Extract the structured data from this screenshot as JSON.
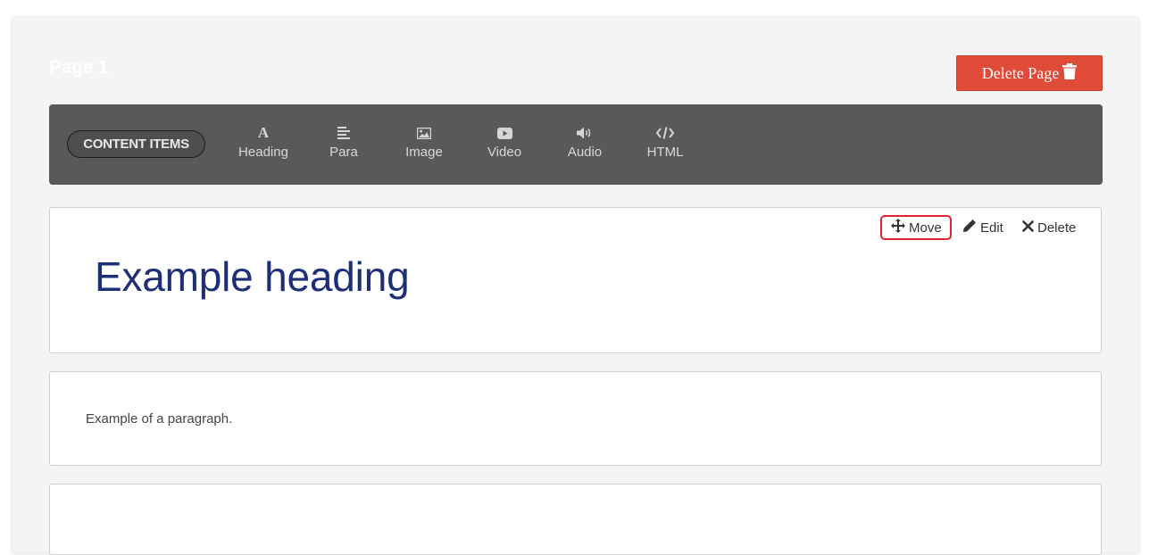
{
  "page": {
    "title": "Page 1",
    "delete_button_label": "Delete Page"
  },
  "toolbar": {
    "content_items_label": "CONTENT ITEMS",
    "tools": [
      {
        "label": "Heading",
        "icon": "heading-icon"
      },
      {
        "label": "Para",
        "icon": "paragraph-icon"
      },
      {
        "label": "Image",
        "icon": "image-icon"
      },
      {
        "label": "Video",
        "icon": "video-icon"
      },
      {
        "label": "Audio",
        "icon": "audio-icon"
      },
      {
        "label": "HTML",
        "icon": "code-icon"
      }
    ]
  },
  "blocks": [
    {
      "type": "heading",
      "text": "Example heading",
      "actions": {
        "move": "Move",
        "edit": "Edit",
        "delete": "Delete"
      }
    },
    {
      "type": "paragraph",
      "text": "Example of a paragraph."
    },
    {
      "type": "empty"
    }
  ],
  "colors": {
    "delete_button": "#e04b3a",
    "toolbar_bg": "#58595b",
    "heading_text": "#1e2f78",
    "highlight_border": "#e0242d"
  }
}
